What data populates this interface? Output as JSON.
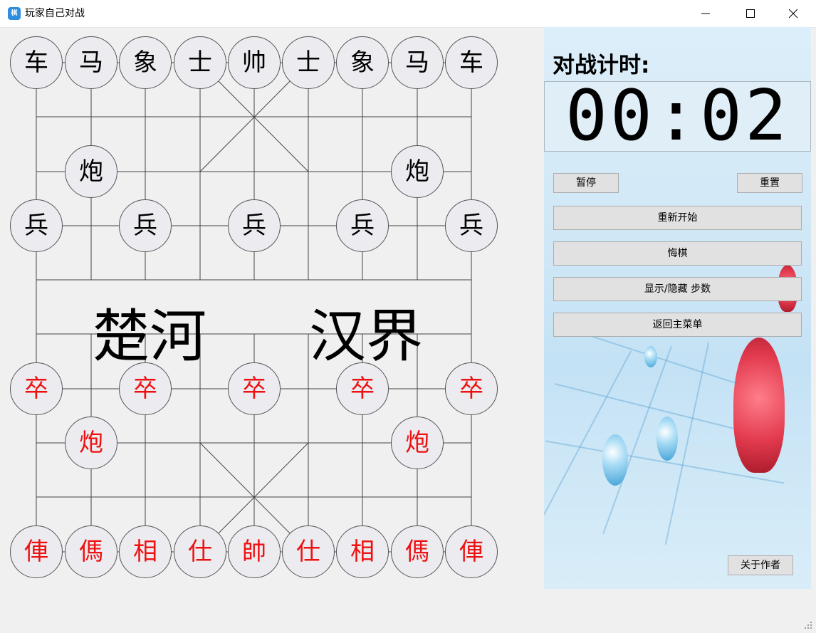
{
  "window": {
    "title": "玩家自己对战",
    "icon": "app-icon",
    "controls": [
      "minimize-icon",
      "maximize-icon",
      "close-icon"
    ]
  },
  "board": {
    "black_back_row": [
      "车",
      "马",
      "象",
      "士",
      "帅",
      "士",
      "象",
      "马",
      "车"
    ],
    "black_cannons": [
      "炮",
      "炮"
    ],
    "black_pawns": [
      "兵",
      "兵",
      "兵",
      "兵",
      "兵"
    ],
    "river_left": "楚河",
    "river_right": "汉界",
    "red_pawns": [
      "卒",
      "卒",
      "卒",
      "卒",
      "卒"
    ],
    "red_cannons": [
      "炮",
      "炮"
    ],
    "red_back_row": [
      "俥",
      "傌",
      "相",
      "仕",
      "帥",
      "仕",
      "相",
      "傌",
      "俥"
    ],
    "colors": {
      "black_piece": "#000000",
      "red_piece": "#ee1111",
      "piece_bg": "#ecebf0"
    }
  },
  "panel": {
    "timer_title": "对战计时:",
    "timer_value": "00:02",
    "pause_label": "暂停",
    "reset_label": "重置",
    "restart_label": "重新开始",
    "undo_label": "悔棋",
    "toggle_steps_label": "显示/隐藏 步数",
    "main_menu_label": "返回主菜单",
    "about_label": "关于作者"
  }
}
